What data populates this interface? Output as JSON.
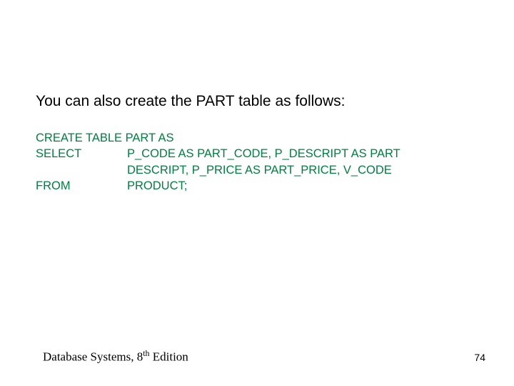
{
  "main": {
    "prose": "You can also create the PART table as follows:",
    "sql": {
      "line1": "CREATE TABLE PART AS",
      "select_kw": "SELECT",
      "select_body1": "P_CODE AS PART_CODE, P_DESCRIPT AS PART",
      "select_body2": "DESCRIPT, P_PRICE AS PART_PRICE, V_CODE",
      "from_kw": "FROM",
      "from_body": "PRODUCT;"
    }
  },
  "footer": {
    "book_prefix": "Database Systems, 8",
    "book_ord": "th",
    "book_suffix": " Edition",
    "page_number": "74"
  }
}
